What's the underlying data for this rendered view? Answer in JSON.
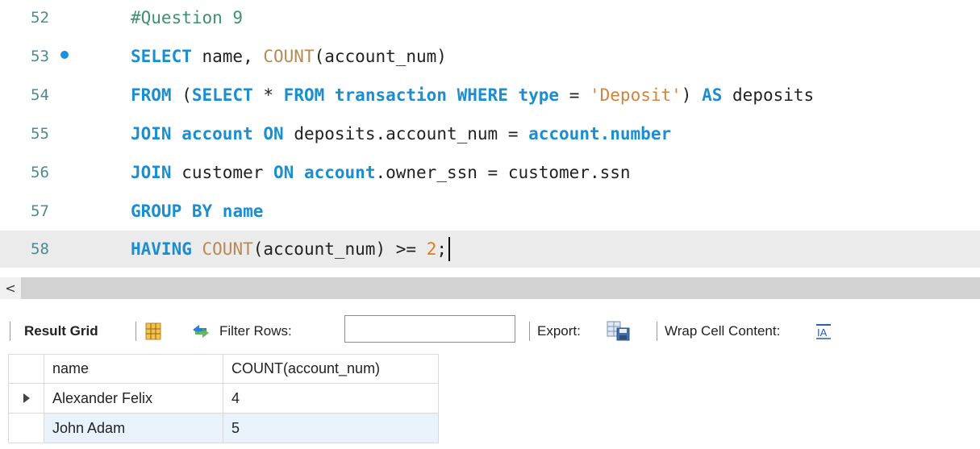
{
  "editor": {
    "lines": [
      {
        "num": "52",
        "tokens": [
          {
            "t": "#Question 9",
            "c": "cm"
          }
        ]
      },
      {
        "num": "53",
        "tokens": [
          {
            "t": "SELECT",
            "c": "kw"
          },
          {
            "t": " name, ",
            "c": "tx"
          },
          {
            "t": "COUNT",
            "c": "fn"
          },
          {
            "t": "(account_num)",
            "c": "tx"
          }
        ]
      },
      {
        "num": "54",
        "tokens": [
          {
            "t": "FROM",
            "c": "kw"
          },
          {
            "t": " (",
            "c": "tx"
          },
          {
            "t": "SELECT",
            "c": "kw"
          },
          {
            "t": " * ",
            "c": "tx"
          },
          {
            "t": "FROM",
            "c": "kw"
          },
          {
            "t": " transaction ",
            "c": "kw"
          },
          {
            "t": "WHERE",
            "c": "kw"
          },
          {
            "t": " type",
            "c": "kw"
          },
          {
            "t": " = ",
            "c": "tx"
          },
          {
            "t": "'Deposit'",
            "c": "str"
          },
          {
            "t": ") ",
            "c": "tx"
          },
          {
            "t": "AS",
            "c": "kw"
          },
          {
            "t": " deposits",
            "c": "tx"
          }
        ]
      },
      {
        "num": "55",
        "tokens": [
          {
            "t": "JOIN",
            "c": "kw"
          },
          {
            "t": " account ",
            "c": "kw"
          },
          {
            "t": "ON",
            "c": "kw"
          },
          {
            "t": " deposits.account_num = ",
            "c": "tx"
          },
          {
            "t": "account.number",
            "c": "kw"
          }
        ]
      },
      {
        "num": "56",
        "tokens": [
          {
            "t": "JOIN",
            "c": "kw"
          },
          {
            "t": " customer ",
            "c": "tx"
          },
          {
            "t": "ON",
            "c": "kw"
          },
          {
            "t": " account",
            "c": "kw"
          },
          {
            "t": ".owner_ssn = customer.ssn",
            "c": "tx"
          }
        ]
      },
      {
        "num": "57",
        "tokens": [
          {
            "t": "GROUP BY",
            "c": "kw"
          },
          {
            "t": " name",
            "c": "kw"
          }
        ]
      },
      {
        "num": "58",
        "tokens": [
          {
            "t": "HAVING",
            "c": "kw"
          },
          {
            "t": " ",
            "c": "tx"
          },
          {
            "t": "COUNT",
            "c": "fn"
          },
          {
            "t": "(account_num) ",
            "c": "tx"
          },
          {
            "t": ">=",
            "c": "tx"
          },
          {
            "t": " 2",
            "c": "num"
          },
          {
            "t": ";",
            "c": "tx"
          }
        ]
      }
    ],
    "breakpoint_line": "53",
    "current_line": "58"
  },
  "scrollbar": {
    "left_arrow": "<"
  },
  "toolbar": {
    "result_grid_label": "Result Grid",
    "filter_rows_label": "Filter Rows:",
    "filter_rows_value": "",
    "export_label": "Export:",
    "wrap_label": "Wrap Cell Content:"
  },
  "grid": {
    "columns": [
      "name",
      "COUNT(account_num)"
    ],
    "rows": [
      {
        "name": "Alexander Felix",
        "count": "4"
      },
      {
        "name": "John Adam",
        "count": "5"
      }
    ]
  },
  "colors": {
    "keyword": "#1a8ecf",
    "string": "#d4833a",
    "number": "#e07d1a",
    "comment": "#3f8f70",
    "line_number": "#4c8b8c",
    "selected_row": "#e9f1fb"
  }
}
